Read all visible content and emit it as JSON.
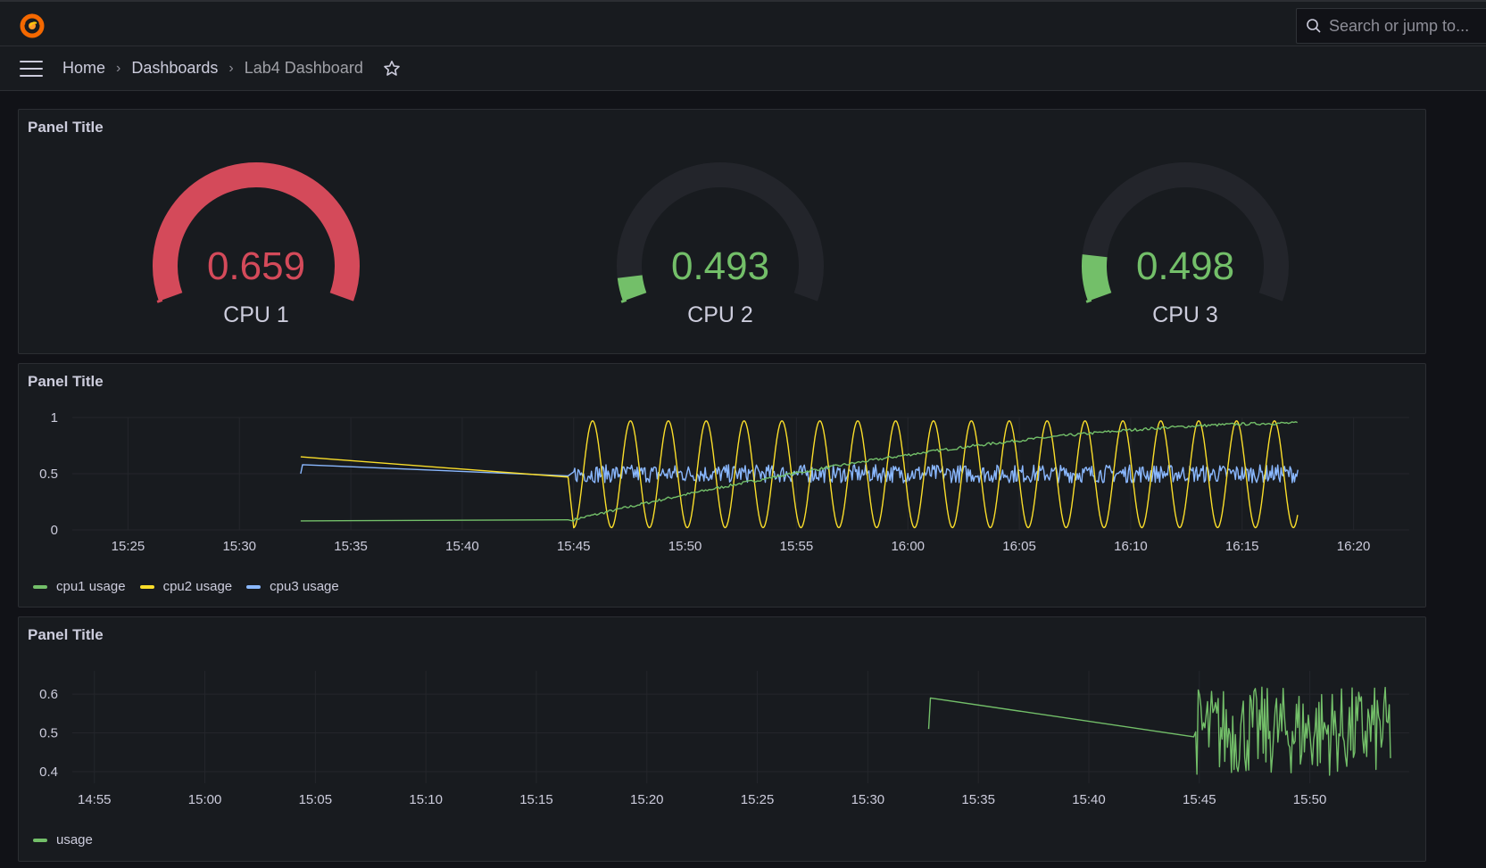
{
  "search": {
    "placeholder": "Search or jump to..."
  },
  "breadcrumb": {
    "home": "Home",
    "dashboards": "Dashboards",
    "current": "Lab4 Dashboard"
  },
  "colors": {
    "red": "#d44a5a",
    "green": "#73bf69",
    "yellow": "#fade2a",
    "blue": "#8ab8ff",
    "track": "#23252b"
  },
  "gauge_panel": {
    "title": "Panel Title",
    "gauges": [
      {
        "value": "0.659",
        "label": "CPU 1",
        "fraction": 1.0,
        "color": "#d44a5a"
      },
      {
        "value": "0.493",
        "label": "CPU 2",
        "fraction": 0.06,
        "color": "#73bf69"
      },
      {
        "value": "0.498",
        "label": "CPU 3",
        "fraction": 0.12,
        "color": "#73bf69"
      }
    ]
  },
  "timeseries_panel": {
    "title": "Panel Title",
    "legend": [
      "cpu1 usage",
      "cpu2 usage",
      "cpu3 usage"
    ]
  },
  "usage_panel": {
    "title": "Panel Title",
    "legend": [
      "usage"
    ]
  },
  "chart_data": [
    {
      "type": "line",
      "title": "Panel Title",
      "x_ticks": [
        "15:25",
        "15:30",
        "15:35",
        "15:40",
        "15:45",
        "15:50",
        "15:55",
        "16:00",
        "16:05",
        "16:10",
        "16:15",
        "16:20"
      ],
      "y_ticks": [
        "1",
        "0.5",
        "0"
      ],
      "xlim": [
        "15:22:30",
        "16:22:30"
      ],
      "ylim": [
        0,
        1
      ],
      "grid": true,
      "legend_position": "bottom-left",
      "series": [
        {
          "name": "cpu1 usage",
          "color": "#73bf69",
          "description": "slow rise with small noise",
          "points": [
            [
              "15:32:45",
              0.08
            ],
            [
              "15:44:45",
              0.09
            ],
            [
              "15:50",
              0.28
            ],
            [
              "15:55",
              0.47
            ],
            [
              "16:00",
              0.68
            ],
            [
              "16:05",
              0.83
            ],
            [
              "16:10",
              0.93
            ],
            [
              "16:17:30",
              0.94
            ]
          ]
        },
        {
          "name": "cpu2 usage",
          "color": "#fade2a",
          "description": "oscillation between ~0.02 and ~0.97, period ~1.7 min",
          "points": [
            [
              "15:32:45",
              0.65
            ],
            [
              "15:44:45",
              0.47
            ],
            [
              "15:45",
              0.05
            ],
            [
              "16:17:30",
              0.15
            ]
          ],
          "period_min": 1.7,
          "min": 0.02,
          "max": 0.97
        },
        {
          "name": "cpu3 usage",
          "color": "#8ab8ff",
          "description": "noise around 0.5",
          "points": [
            [
              "15:32:45",
              0.5
            ],
            [
              "15:32:50",
              0.58
            ],
            [
              "15:44:45",
              0.48
            ],
            [
              "16:17:30",
              0.52
            ]
          ],
          "noise_center": 0.5,
          "noise_amp": 0.07
        }
      ]
    },
    {
      "type": "line",
      "title": "Panel Title",
      "x_ticks": [
        "14:55",
        "15:00",
        "15:05",
        "15:10",
        "15:15",
        "15:20",
        "15:25",
        "15:30",
        "15:35",
        "15:40",
        "15:45",
        "15:50"
      ],
      "y_ticks": [
        "0.6",
        "0.5",
        "0.4"
      ],
      "xlim": [
        "14:54:00",
        "15:54:30"
      ],
      "ylim": [
        0.37,
        0.66
      ],
      "grid": true,
      "legend_position": "bottom-left",
      "series": [
        {
          "name": "usage",
          "color": "#73bf69",
          "description": "single line then dense noise between ~0.39 and ~0.62",
          "points": [
            [
              "15:32:45",
              0.51
            ],
            [
              "15:32:50",
              0.59
            ],
            [
              "15:44:45",
              0.49
            ]
          ],
          "noise_start": "15:44:50",
          "noise_end": "15:53:40",
          "noise_min": 0.39,
          "noise_max": 0.62
        }
      ]
    }
  ]
}
